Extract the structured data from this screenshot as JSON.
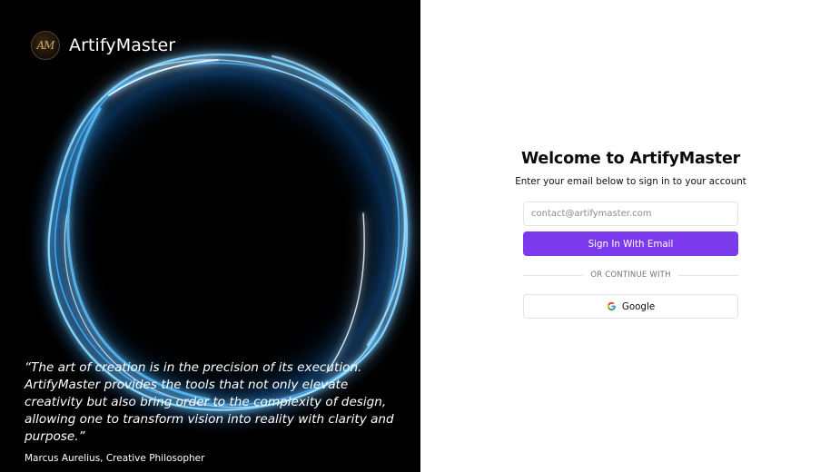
{
  "brand": {
    "name": "ArtifyMaster",
    "logo_monogram": "AM",
    "logo_icon": "monogram-logo-icon"
  },
  "testimonial": {
    "quote": "“The art of creation is in the precision of its execution. ArtifyMaster provides the tools that not only elevate creativity but also bring order to the complexity of design, allowing one to transform vision into reality with clarity and purpose.”",
    "author": "Marcus Aurelius, Creative Philosopher"
  },
  "login": {
    "title": "Welcome to ArtifyMaster",
    "subtitle": "Enter your email below to sign in to your account",
    "email_placeholder": "contact@artifymaster.com",
    "email_value": "",
    "signin_label": "Sign In With Email",
    "divider_label": "OR CONTINUE WITH",
    "google_label": "Google",
    "google_icon": "google-icon"
  },
  "colors": {
    "accent": "#7c3aed",
    "left_panel_bg": "#000000",
    "ring_glow": "#2ea3ff"
  }
}
